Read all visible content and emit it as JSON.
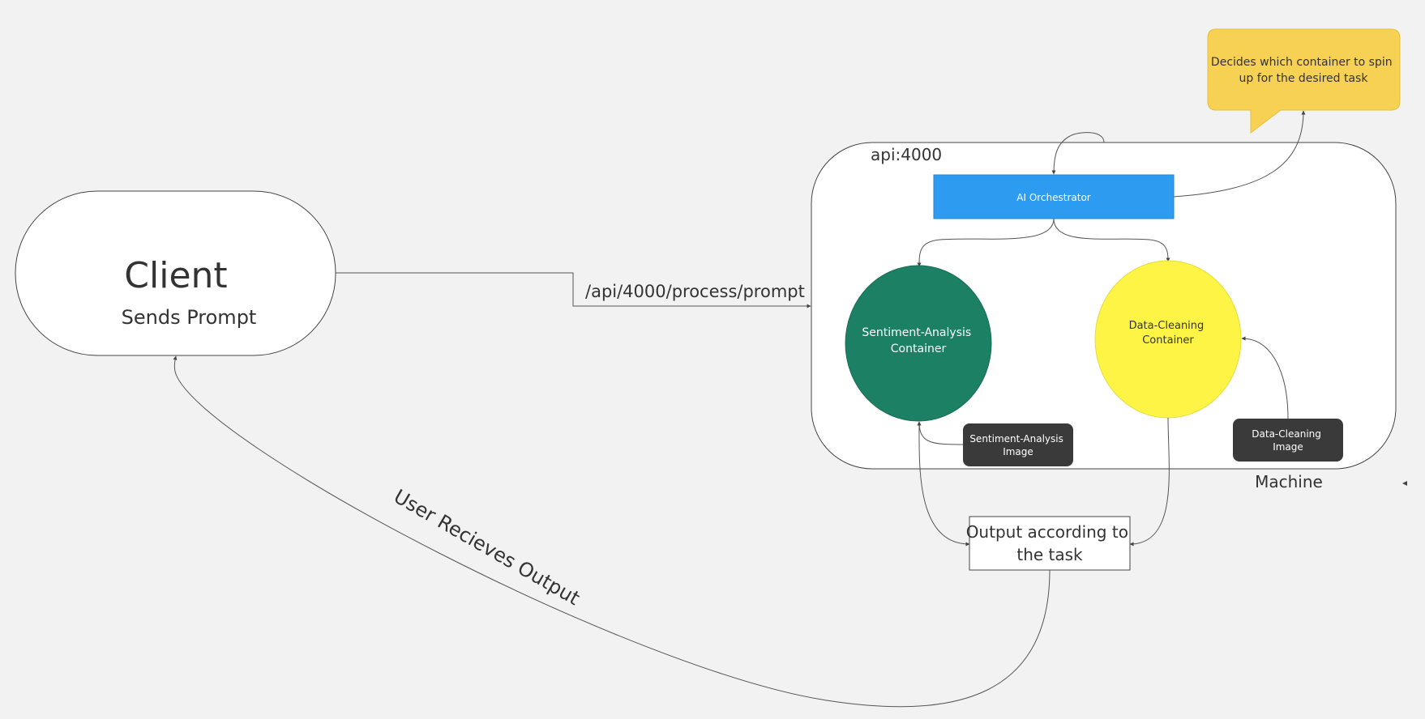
{
  "client": {
    "title": "Client",
    "subtitle": "Sends Prompt"
  },
  "request_label": "/api/4000/process/prompt",
  "machine": {
    "port_label": "api:4000",
    "caption": "Machine"
  },
  "orchestrator": {
    "label": "AI Orchestrator"
  },
  "sticky_note": {
    "lines": [
      "Decides which container to spin",
      "up for the desired task"
    ]
  },
  "sentiment_container": {
    "lines": [
      "Sentiment-Analysis",
      "Container"
    ]
  },
  "cleaning_container": {
    "lines": [
      "Data-Cleaning",
      "Container"
    ]
  },
  "sentiment_image": {
    "lines": [
      "Sentiment-Analysis",
      "Image"
    ]
  },
  "cleaning_image": {
    "lines": [
      "Data-Cleaning",
      "Image"
    ]
  },
  "output_box": {
    "lines": [
      "Output according to",
      "the task"
    ]
  },
  "return_label": "User Recieves Output",
  "colors": {
    "background": "#f2f2f2",
    "orchestrator": "#2d9bf0",
    "sentiment_container": "#1c8065",
    "cleaning_container": "#fef445",
    "image_box": "#3a3a3a",
    "sticky_note": "#f7d154",
    "line": "#555555"
  }
}
